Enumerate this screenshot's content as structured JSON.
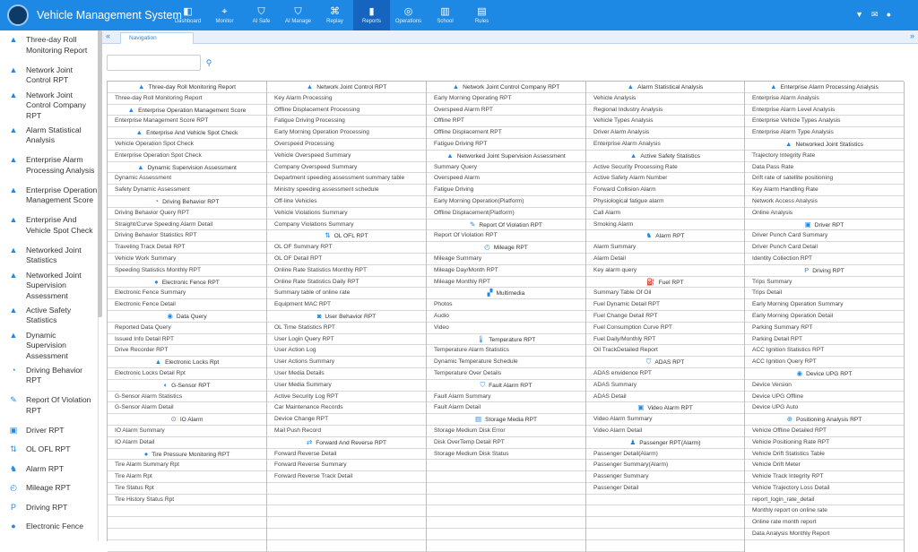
{
  "app": {
    "title": "Vehicle Management System"
  },
  "nav": [
    {
      "label": "Dashboard",
      "icon": "◧",
      "iconName": "dashboard-icon"
    },
    {
      "label": "Monitor",
      "icon": "⌖",
      "iconName": "location-pin-icon"
    },
    {
      "label": "AI Safe",
      "icon": "⛉",
      "iconName": "shield-icon"
    },
    {
      "label": "AI Manage",
      "icon": "⛉",
      "iconName": "shield-manage-icon"
    },
    {
      "label": "Replay",
      "icon": "⌘",
      "iconName": "replay-icon"
    },
    {
      "label": "Reports",
      "icon": "▮",
      "iconName": "bar-chart-icon"
    },
    {
      "label": "Operations",
      "icon": "◎",
      "iconName": "globe-icon"
    },
    {
      "label": "School",
      "icon": "▥",
      "iconName": "school-icon"
    },
    {
      "label": "Rules",
      "icon": "▤",
      "iconName": "rules-icon"
    }
  ],
  "sidebar": [
    {
      "label": "Three-day Roll Monitoring Report",
      "icon": "▲"
    },
    {
      "label": "Network Joint Control RPT",
      "icon": "▲"
    },
    {
      "label": "Network Joint Control Company RPT",
      "icon": "▲"
    },
    {
      "label": "Alarm Statistical Analysis",
      "icon": "▲"
    },
    {
      "label": "Enterprise Alarm Processing Analysis",
      "icon": "▲"
    },
    {
      "label": "Enterprise Operation Management Score",
      "icon": "▲"
    },
    {
      "label": "Enterprise And Vehicle Spot Check",
      "icon": "▲"
    },
    {
      "label": "Networked Joint Statistics",
      "icon": "▲"
    },
    {
      "label": "Networked Joint Supervision Assessment",
      "icon": "▲"
    },
    {
      "label": "Active Safety Statistics",
      "icon": "▲"
    },
    {
      "label": "Dynamic Supervision Assessment",
      "icon": "▲"
    },
    {
      "label": "Driving Behavior RPT",
      "icon": "◔"
    },
    {
      "label": "Report Of Violation RPT",
      "icon": "✎"
    },
    {
      "label": "Driver RPT",
      "icon": "▣",
      "single": true
    },
    {
      "label": "OL OFL RPT",
      "icon": "⇅",
      "single": true
    },
    {
      "label": "Alarm RPT",
      "icon": "♞",
      "single": true
    },
    {
      "label": "Mileage RPT",
      "icon": "◴",
      "single": true
    },
    {
      "label": "Driving RPT",
      "icon": "P",
      "single": true
    },
    {
      "label": "Electronic Fence",
      "icon": "●",
      "single": true
    }
  ],
  "tabs": {
    "navigation": "Navigation"
  },
  "search": {
    "placeholder": "",
    "icon": "⚲"
  },
  "columns": [
    [
      {
        "t": "Three-day Roll Monitoring Report",
        "h": true,
        "icon": "▲"
      },
      {
        "t": "Three-day Roll Monitoring Report"
      },
      {
        "t": "Enterprise Operation Management Score",
        "h": true,
        "icon": "▲"
      },
      {
        "t": "Enterprise Management Score RPT"
      },
      {
        "t": "Enterprise And Vehicle Spot Check",
        "h": true,
        "icon": "▲"
      },
      {
        "t": "Vehicle Operation Spot Check"
      },
      {
        "t": "Enterprise Operation Spot Check"
      },
      {
        "t": "Dynamic Supervision Assessment",
        "h": true,
        "icon": "▲"
      },
      {
        "t": "Dynamic Assessment"
      },
      {
        "t": "Safety Dynamic Assessment"
      },
      {
        "t": "Driving Behavior RPT",
        "h": true,
        "icon": "◔"
      },
      {
        "t": "Driving Behavior Query RPT"
      },
      {
        "t": "Straight/Curve Speeding Alarm Detail"
      },
      {
        "t": "Driving Behavior Statistics RPT"
      },
      {
        "t": "Traveling Track Detail RPT"
      },
      {
        "t": "Vehicle Work Summary"
      },
      {
        "t": "Speeding Statistics Monthly RPT"
      },
      {
        "t": "Electronic Fence RPT",
        "h": true,
        "icon": "●"
      },
      {
        "t": "Electronic Fence Summary"
      },
      {
        "t": "Electronic Fence Detail"
      },
      {
        "t": "Data Query",
        "h": true,
        "icon": "◉"
      },
      {
        "t": "Reported Data Query"
      },
      {
        "t": "Issued Info Detail RPT"
      },
      {
        "t": "Drive Recorder RPT"
      },
      {
        "t": "Electronic Locks Rpt",
        "h": true,
        "icon": "▲"
      },
      {
        "t": "Electronic Locks Detail Rpt"
      },
      {
        "t": "G-Sensor RPT",
        "h": true,
        "icon": "◐"
      },
      {
        "t": "G-Sensor Alarm Statistics"
      },
      {
        "t": "G-Sensor Alarm Detail"
      },
      {
        "t": "IO Alarm",
        "h": true,
        "icon": "⊙"
      },
      {
        "t": "IO Alarm Summary"
      },
      {
        "t": "IO Alarm Detail"
      },
      {
        "t": "Tire Pressure Monitoring RPT",
        "h": true,
        "icon": "●"
      },
      {
        "t": "Tire Alarm Summary Rpt"
      },
      {
        "t": "Tire Alarm Rpt"
      },
      {
        "t": "Tire Status Rpt"
      },
      {
        "t": "Tire History Status Rpt"
      },
      {
        "t": ""
      },
      {
        "t": ""
      },
      {
        "t": ""
      },
      {
        "t": ""
      }
    ],
    [
      {
        "t": "Network Joint Control RPT",
        "h": true,
        "icon": "▲"
      },
      {
        "t": "Key Alarm Processing"
      },
      {
        "t": "Offline Displacement Processing"
      },
      {
        "t": "Fatigue Driving Processing"
      },
      {
        "t": "Early Morning Operation Processing"
      },
      {
        "t": "Overspeed Processing"
      },
      {
        "t": "Vehicle Overspeed Summary"
      },
      {
        "t": "Company Overspeed Summary"
      },
      {
        "t": "Department speeding assessment summary table"
      },
      {
        "t": "Ministry speeding assessment schedule"
      },
      {
        "t": "Off-line Vehicles"
      },
      {
        "t": "Vehicle Violations Summary"
      },
      {
        "t": "Company Violations Summary"
      },
      {
        "t": "OL OFL RPT",
        "h": true,
        "icon": "⇅"
      },
      {
        "t": "OL OF Summary RPT"
      },
      {
        "t": "OL OF Detail RPT"
      },
      {
        "t": "Online Rate Statistics Monthly RPT"
      },
      {
        "t": "Online Rate Statistics Daily RPT"
      },
      {
        "t": "Summary table of online rate"
      },
      {
        "t": "Equipment MAC RPT"
      },
      {
        "t": "User Behavior RPT",
        "h": true,
        "icon": "◙"
      },
      {
        "t": "OL Time Statistics RPT"
      },
      {
        "t": "User Login Query RPT"
      },
      {
        "t": "User Action Log"
      },
      {
        "t": "User Actions Summary"
      },
      {
        "t": "User Media Details"
      },
      {
        "t": "User Media Summary"
      },
      {
        "t": "Active Security Log RPT"
      },
      {
        "t": "Car Maintenance Records"
      },
      {
        "t": "Device Change RPT"
      },
      {
        "t": "Mail Push Record"
      },
      {
        "t": "Forward And Reverse RPT",
        "h": true,
        "icon": "⇄"
      },
      {
        "t": "Forward Reverse Detail"
      },
      {
        "t": "Forward Reverse Summary"
      },
      {
        "t": "Forward Reverse Track Detail"
      },
      {
        "t": ""
      },
      {
        "t": ""
      },
      {
        "t": ""
      },
      {
        "t": ""
      },
      {
        "t": ""
      },
      {
        "t": ""
      }
    ],
    [
      {
        "t": "Network Joint Control Company RPT",
        "h": true,
        "icon": "▲"
      },
      {
        "t": "Early Morning Operating RPT"
      },
      {
        "t": "Overspeed Alarm RPT"
      },
      {
        "t": "Offline RPT"
      },
      {
        "t": "Offline Displacement RPT"
      },
      {
        "t": "Fatigue Driving RPT"
      },
      {
        "t": "Networked Joint Supervision Assessment",
        "h": true,
        "icon": "▲"
      },
      {
        "t": "Summary Query"
      },
      {
        "t": "Overspeed Alarm"
      },
      {
        "t": "Fatigue Driving"
      },
      {
        "t": "Early Morning Operation(Platform)"
      },
      {
        "t": "Offline Displacement(Platform)"
      },
      {
        "t": "Report Of Violation RPT",
        "h": true,
        "icon": "✎"
      },
      {
        "t": "Report Of Violation RPT"
      },
      {
        "t": "Mileage RPT",
        "h": true,
        "icon": "◴"
      },
      {
        "t": "Mileage Summary"
      },
      {
        "t": "Mileage Day/Month RPT"
      },
      {
        "t": "Mileage Monthly RPT"
      },
      {
        "t": "Multimedia",
        "h": true,
        "icon": "▞"
      },
      {
        "t": "Photos"
      },
      {
        "t": "Audio"
      },
      {
        "t": "Video"
      },
      {
        "t": "Temperature RPT",
        "h": true,
        "icon": "🌡"
      },
      {
        "t": "Temperature Alarm Statistics"
      },
      {
        "t": "Dynamic Temperature Schedule"
      },
      {
        "t": "Temperature Over Details"
      },
      {
        "t": "Fault Alarm RPT",
        "h": true,
        "icon": "⛉"
      },
      {
        "t": "Fault Alarm Summary"
      },
      {
        "t": "Fault Alarm Detail"
      },
      {
        "t": "Storage Media RPT",
        "h": true,
        "icon": "▤"
      },
      {
        "t": "Storage Medium Disk Error"
      },
      {
        "t": "Disk OverTemp Detail RPT"
      },
      {
        "t": "Storage Medium Disk Status"
      },
      {
        "t": ""
      },
      {
        "t": ""
      },
      {
        "t": ""
      },
      {
        "t": ""
      },
      {
        "t": ""
      },
      {
        "t": ""
      },
      {
        "t": ""
      },
      {
        "t": ""
      }
    ],
    [
      {
        "t": "Alarm Statistical Analysis",
        "h": true,
        "icon": "▲"
      },
      {
        "t": "Vehicle Analysis"
      },
      {
        "t": "Regional Industry Analysis"
      },
      {
        "t": "Vehicle Types Analysis"
      },
      {
        "t": "Driver Alarm Analysis"
      },
      {
        "t": "Enterprise Alarm Analysis"
      },
      {
        "t": "Active Safety Statistics",
        "h": true,
        "icon": "▲"
      },
      {
        "t": "Active Security Processing Rate"
      },
      {
        "t": "Active Safety Alarm Number"
      },
      {
        "t": "Forward Collision Alarm"
      },
      {
        "t": "Physiological fatigue alarm"
      },
      {
        "t": "Call Alarm"
      },
      {
        "t": "Smoking Alarm"
      },
      {
        "t": "Alarm RPT",
        "h": true,
        "icon": "♞"
      },
      {
        "t": "Alarm Summary"
      },
      {
        "t": "Alarm Detail"
      },
      {
        "t": "Key alarm query"
      },
      {
        "t": "Fuel RPT",
        "h": true,
        "icon": "⛽"
      },
      {
        "t": "Summary Table Of Oil"
      },
      {
        "t": "Fuel Dynamic Detail RPT"
      },
      {
        "t": "Fuel Change Detail RPT"
      },
      {
        "t": "Fuel Consumption Curve RPT"
      },
      {
        "t": "Fuel Daily/Monthly RPT"
      },
      {
        "t": "Oil TrackDetailed Report"
      },
      {
        "t": "ADAS RPT",
        "h": true,
        "icon": "⛉"
      },
      {
        "t": "ADAS envidence RPT"
      },
      {
        "t": "ADAS Summary"
      },
      {
        "t": "ADAS Detail"
      },
      {
        "t": "Video Alarm RPT",
        "h": true,
        "icon": "▣"
      },
      {
        "t": "Video Alarm Summary"
      },
      {
        "t": "Video Alarm Detail"
      },
      {
        "t": "Passenger RPT(Alarm)",
        "h": true,
        "icon": "♟"
      },
      {
        "t": "Passenger Detail(Alarm)"
      },
      {
        "t": "Passenger Summary(Alarm)"
      },
      {
        "t": "Passenger Summary"
      },
      {
        "t": "Passenger Detail"
      },
      {
        "t": ""
      },
      {
        "t": ""
      },
      {
        "t": ""
      },
      {
        "t": ""
      },
      {
        "t": ""
      }
    ],
    [
      {
        "t": "Enterprise Alarm Processing Analysis",
        "h": true,
        "icon": "▲"
      },
      {
        "t": "Enterprise Alarm Analysis"
      },
      {
        "t": "Enterprise Alarm Level Analysis"
      },
      {
        "t": "Enterprise Vehicle Types Analysis"
      },
      {
        "t": "Enterprise Alarm Type Analysis"
      },
      {
        "t": "Networked Joint Statistics",
        "h": true,
        "icon": "▲"
      },
      {
        "t": "Trajectory Integrity Rate"
      },
      {
        "t": "Data Pass Rate"
      },
      {
        "t": "Drift rate of satellite positioning"
      },
      {
        "t": "Key Alarm Handling Rate"
      },
      {
        "t": "Network Access Analysis"
      },
      {
        "t": "Online Analysis"
      },
      {
        "t": "Driver RPT",
        "h": true,
        "icon": "▣"
      },
      {
        "t": "Driver Punch Card Summary"
      },
      {
        "t": "Driver Punch Card Detail"
      },
      {
        "t": "Identity Collection RPT"
      },
      {
        "t": "Driving RPT",
        "h": true,
        "icon": "P"
      },
      {
        "t": "Trips Summary"
      },
      {
        "t": "Trips Detail"
      },
      {
        "t": "Early Morning Operation Summary"
      },
      {
        "t": "Early Morning Operation Detail"
      },
      {
        "t": "Parking Summary RPT"
      },
      {
        "t": "Parking Detail RPT"
      },
      {
        "t": "ACC Ignition Statistics RPT"
      },
      {
        "t": "ACC Ignition Query RPT"
      },
      {
        "t": "Device UPG RPT",
        "h": true,
        "icon": "◉"
      },
      {
        "t": "Device Version"
      },
      {
        "t": "Device UPG Offline"
      },
      {
        "t": "Device UPG Auto"
      },
      {
        "t": "Positioning Analysis RPT",
        "h": true,
        "icon": "⊕"
      },
      {
        "t": "Vehicle Offline Detailed RPT"
      },
      {
        "t": "Vehicle Positioning Rate RPT"
      },
      {
        "t": "Vehicle Drift Statistics Table"
      },
      {
        "t": "Vehicle Drift Meter"
      },
      {
        "t": "Vehicle Track Integrity RPT"
      },
      {
        "t": "Vehicle Trajectory Loss Detail"
      },
      {
        "t": "report_login_rate_detail"
      },
      {
        "t": "Monthly report on online rate"
      },
      {
        "t": "Online rate month report"
      },
      {
        "t": "Data Analysis Monthly Report"
      }
    ]
  ]
}
